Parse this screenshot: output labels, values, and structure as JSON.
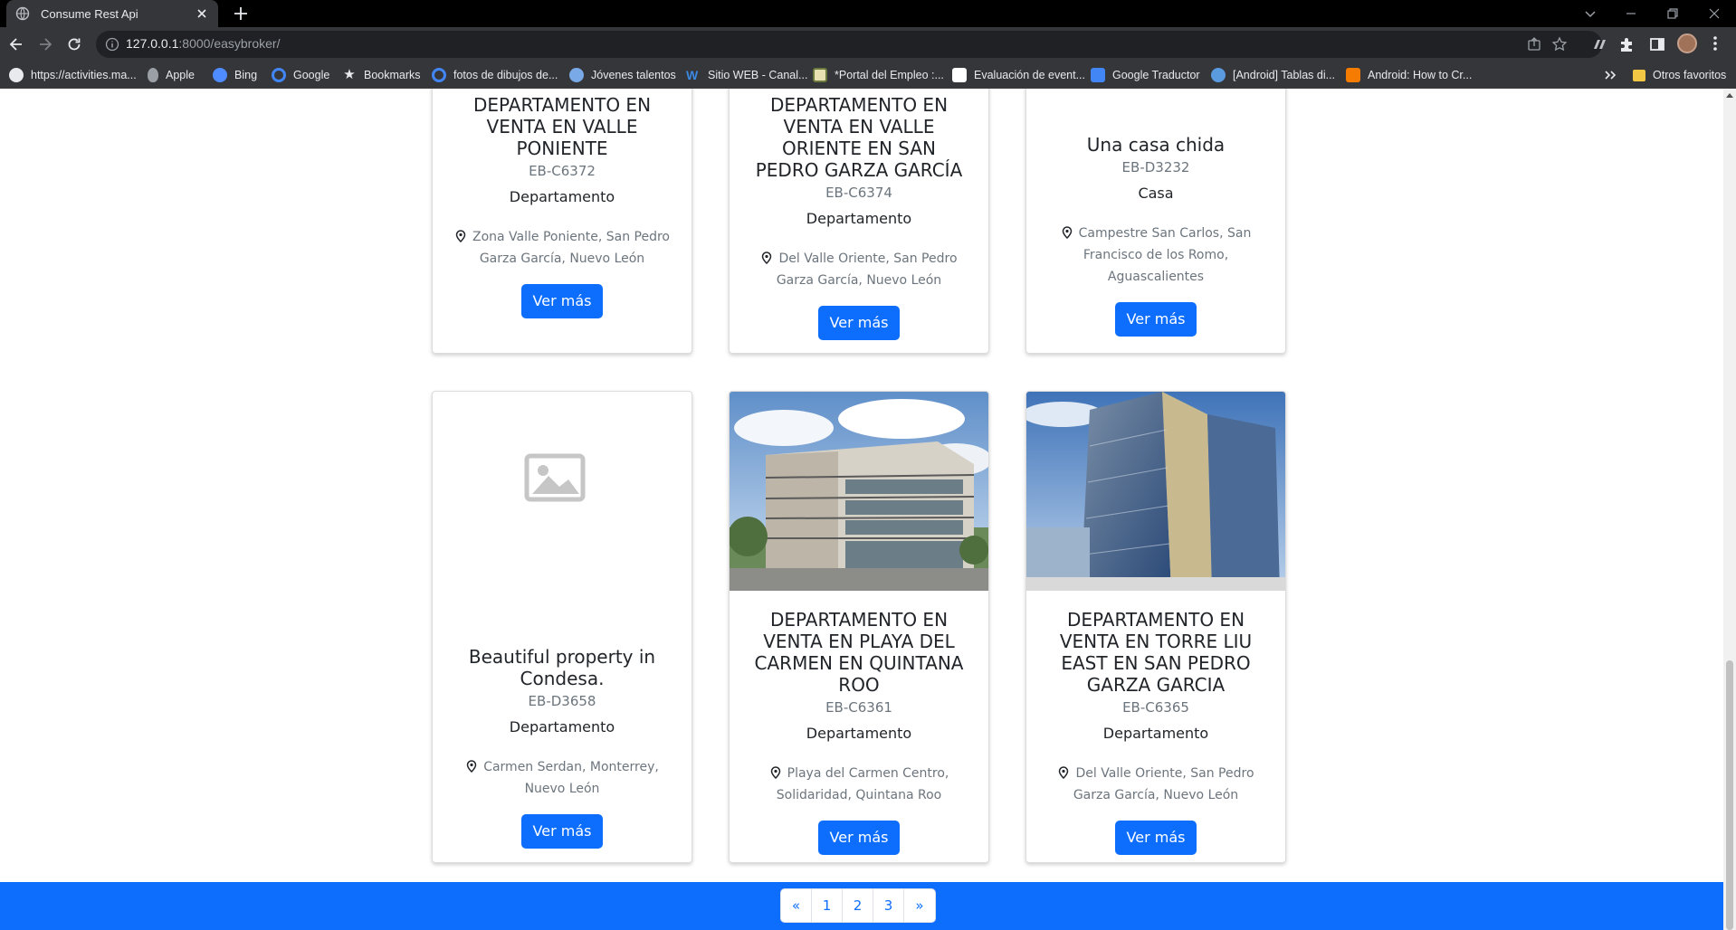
{
  "browser": {
    "tab_title": "Consume Rest Api",
    "url_host": "127.0.0.1",
    "url_rest": ":8000/easybroker/"
  },
  "bookmarks": [
    {
      "label": "https://activities.ma...",
      "icon": "globe-icon",
      "color": "#e8eaed"
    },
    {
      "label": "Apple",
      "icon": "apple-icon",
      "color": "#9aa0a6"
    },
    {
      "label": "Bing",
      "icon": "bing-icon",
      "color": "#4e8cff"
    },
    {
      "label": "Google",
      "icon": "google-icon",
      "color": "#4285f4"
    },
    {
      "label": "Bookmarks",
      "icon": "star-icon",
      "color": "#e8eaed"
    },
    {
      "label": "fotos de dibujos de...",
      "icon": "google-icon",
      "color": "#4285f4"
    },
    {
      "label": "Jóvenes talentos",
      "icon": "site-icon",
      "color": "#7aa9e8"
    },
    {
      "label": "Sitio WEB - Canal...",
      "icon": "weebly-icon",
      "color": "#3b88e0"
    },
    {
      "label": "*Portal del Empleo :...",
      "icon": "portal-icon",
      "color": "#e8e0b0"
    },
    {
      "label": "Evaluación de event...",
      "icon": "eval-icon",
      "color": "#ffffff"
    },
    {
      "label": "Google Traductor",
      "icon": "translate-icon",
      "color": "#4285f4"
    },
    {
      "label": "[Android] Tablas di...",
      "icon": "wordpress-icon",
      "color": "#5a9be0"
    },
    {
      "label": "Android: How to Cr...",
      "icon": "blogger-icon",
      "color": "#f57c00"
    }
  ],
  "other_bookmarks": "Otros favoritos",
  "cards": [
    {
      "title": "DEPARTAMENTO EN VENTA EN VALLE PONIENTE",
      "code": "EB-C6372",
      "type": "Departamento",
      "location": "Zona Valle Poniente, San Pedro Garza García, Nuevo León",
      "button": "Ver más"
    },
    {
      "title": "DEPARTAMENTO EN VENTA EN VALLE ORIENTE EN SAN PEDRO GARZA GARCÍA",
      "code": "EB-C6374",
      "type": "Departamento",
      "location": "Del Valle Oriente, San Pedro Garza García, Nuevo León",
      "button": "Ver más"
    },
    {
      "title": "Una casa chida",
      "code": "EB-D3232",
      "type": "Casa",
      "location": "Campestre San Carlos, San Francisco de los Romo, Aguascalientes",
      "button": "Ver más"
    },
    {
      "title": "Beautiful property in Condesa.",
      "code": "EB-D3658",
      "type": "Departamento",
      "location": "Carmen Serdan, Monterrey, Nuevo León",
      "button": "Ver más"
    },
    {
      "title": "DEPARTAMENTO EN VENTA EN PLAYA DEL CARMEN EN QUINTANA ROO",
      "code": "EB-C6361",
      "type": "Departamento",
      "location": "Playa del Carmen Centro, Solidaridad, Quintana Roo",
      "button": "Ver más"
    },
    {
      "title": "DEPARTAMENTO EN VENTA EN TORRE LIU EAST EN SAN PEDRO GARZA GARCIA",
      "code": "EB-C6365",
      "type": "Departamento",
      "location": "Del Valle Oriente, San Pedro Garza García, Nuevo León",
      "button": "Ver más"
    }
  ],
  "pagination": [
    "«",
    "1",
    "2",
    "3",
    "»"
  ],
  "colors": {
    "primary": "#0d6efd",
    "muted": "#6c757d"
  }
}
